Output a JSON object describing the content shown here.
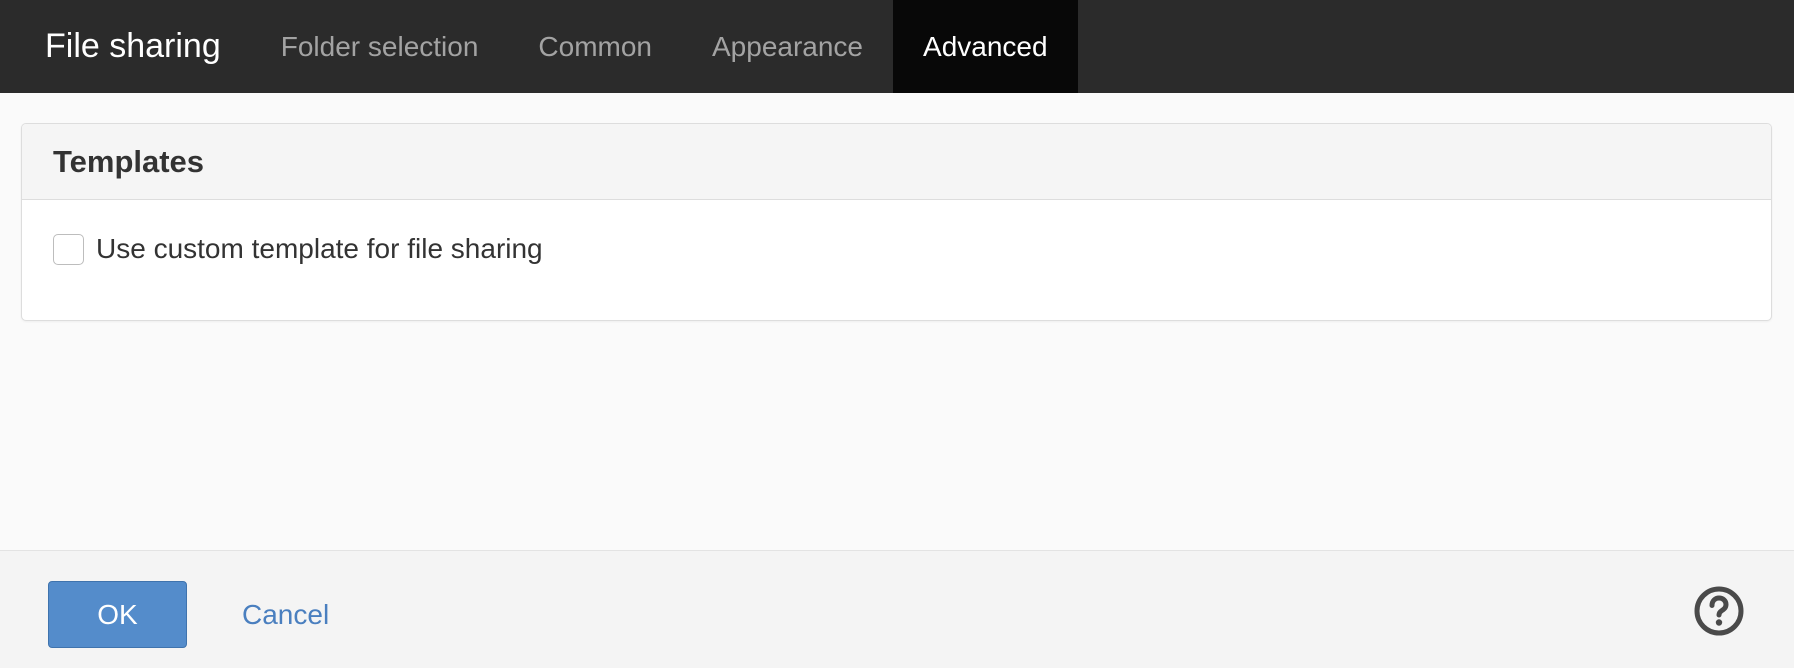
{
  "header": {
    "title": "File sharing",
    "tabs": [
      {
        "label": "Folder selection",
        "active": false
      },
      {
        "label": "Common",
        "active": false
      },
      {
        "label": "Appearance",
        "active": false
      },
      {
        "label": "Advanced",
        "active": true
      }
    ]
  },
  "templates_panel": {
    "heading": "Templates",
    "custom_template": {
      "label": "Use custom template for file sharing",
      "checked": false
    }
  },
  "footer": {
    "ok_label": "OK",
    "cancel_label": "Cancel",
    "help_icon": "help-circle-icon"
  },
  "colors": {
    "topbar_bg": "#2b2b2b",
    "active_tab_bg": "#080808",
    "primary_button": "#548ccb",
    "link": "#4a7fbf"
  }
}
